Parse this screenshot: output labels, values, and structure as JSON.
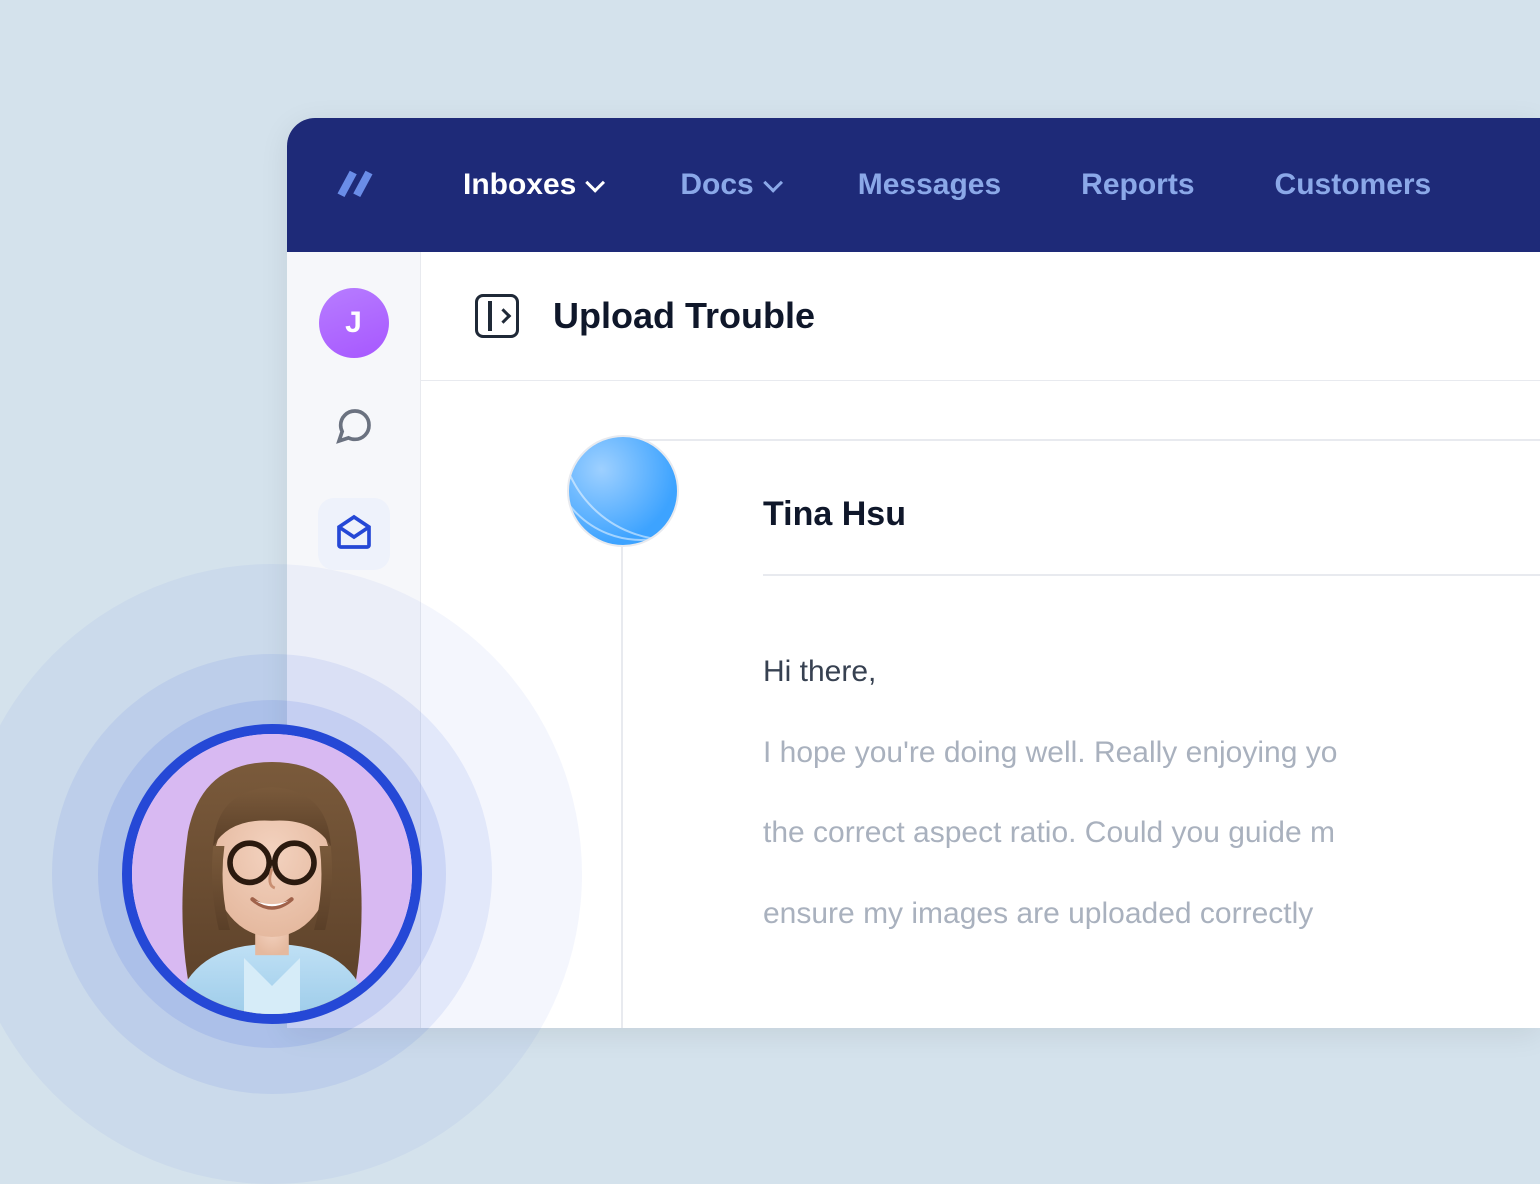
{
  "nav": {
    "items": [
      {
        "label": "Inboxes",
        "hasDropdown": true,
        "active": true
      },
      {
        "label": "Docs",
        "hasDropdown": true,
        "active": false
      },
      {
        "label": "Messages",
        "hasDropdown": false,
        "active": false
      },
      {
        "label": "Reports",
        "hasDropdown": false,
        "active": false
      },
      {
        "label": "Customers",
        "hasDropdown": false,
        "active": false
      }
    ]
  },
  "sidebar": {
    "avatarInitial": "J",
    "icons": [
      {
        "name": "chat-icon",
        "active": false
      },
      {
        "name": "mail-icon",
        "active": true
      }
    ]
  },
  "thread": {
    "title": "Upload Trouble"
  },
  "message": {
    "senderName": "Tina Hsu",
    "greeting": "Hi there,",
    "body1": "I hope you're doing well. Really enjoying yo",
    "body2": "the correct aspect ratio. Could you guide m",
    "body3": "ensure my images are uploaded correctly"
  },
  "colors": {
    "navBg": "#1e2a78",
    "navInactive": "#8ba8e8",
    "accent": "#2548d6",
    "avatarPurple": "#a757ff"
  }
}
